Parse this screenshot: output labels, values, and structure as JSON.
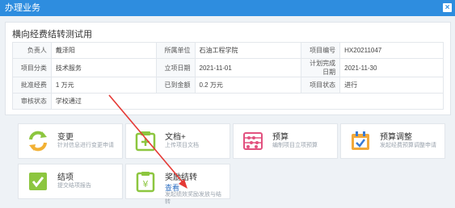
{
  "window": {
    "title": "办理业务",
    "close_symbol": "×"
  },
  "panel": {
    "title": "横向经费结转测试用"
  },
  "info_rows": [
    [
      {
        "k": "负责人",
        "v": "戴泽阳"
      },
      {
        "k": "所属单位",
        "v": "石油工程学院"
      },
      {
        "k": "项目编号",
        "v": "HX20211047"
      }
    ],
    [
      {
        "k": "项目分类",
        "v": "技术服务"
      },
      {
        "k": "立项日期",
        "v": "2021-11-01"
      },
      {
        "k": "计划完成日期",
        "v": "2021-11-30"
      }
    ],
    [
      {
        "k": "批准经费",
        "v": "1 万元"
      },
      {
        "k": "已到金额",
        "v": "0.2 万元"
      },
      {
        "k": "项目状态",
        "v": "进行"
      }
    ],
    [
      {
        "k": "审核状态",
        "v": "学校通过"
      }
    ]
  ],
  "cards": [
    {
      "title": "变更",
      "desc": "针对信息进行变更申请",
      "icon": "refresh-icon",
      "color": "#8cc63f"
    },
    {
      "title": "文档+",
      "desc": "上传项目文档",
      "icon": "document-add-icon",
      "color": "#8cc63f"
    },
    {
      "title": "预算",
      "desc": "编制项目立项预算",
      "icon": "abacus-icon",
      "color": "#e2517f"
    },
    {
      "title": "预算调整",
      "desc": "发起经费预算调整申请",
      "icon": "calendar-check-icon",
      "color": "#f2a93b"
    },
    {
      "title": "结项",
      "desc": "提交结项报告",
      "icon": "check-board-icon",
      "color": "#8cc63f"
    },
    {
      "title": "奖励结转",
      "link": "查看",
      "desc": "发起绩效奖励发放与结转",
      "icon": "clipboard-yen-icon",
      "color": "#8cc63f"
    }
  ],
  "annotation": {
    "arrow_color": "#e53935"
  }
}
